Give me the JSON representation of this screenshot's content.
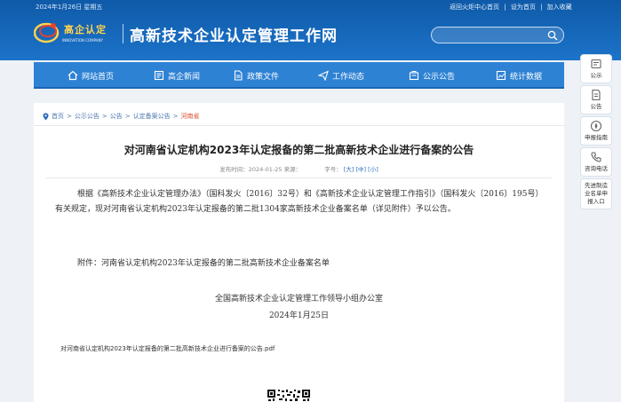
{
  "topbar": {
    "date": "2024年1月26日 星期五",
    "links": [
      "返回火炬中心首页",
      "|",
      "设为首页",
      "|",
      "加入收藏"
    ]
  },
  "brand": {
    "logo_cn": "高企认定",
    "logo_en": "INNOVATION COMPANY",
    "site_title": "高新技术企业认定管理工作网"
  },
  "search": {
    "placeholder": "",
    "icon": "search-icon"
  },
  "nav": {
    "items": [
      {
        "label": "网站首页",
        "icon": "home-icon"
      },
      {
        "label": "高企新闻",
        "icon": "news-icon"
      },
      {
        "label": "政策文件",
        "icon": "document-icon"
      },
      {
        "label": "工作动态",
        "icon": "send-icon"
      },
      {
        "label": "公示公告",
        "icon": "announcement-icon"
      },
      {
        "label": "统计数据",
        "icon": "chart-icon"
      }
    ]
  },
  "breadcrumb": {
    "items": [
      "首页",
      ">",
      "公示公告",
      ">",
      "公告",
      ">",
      "认定备案公告",
      ">"
    ],
    "current": "河南省"
  },
  "article": {
    "title": "对河南省认定机构2023年认定报备的第二批高新技术企业进行备案的公告",
    "meta_time": "发布时间：2024-01-25 来源：",
    "meta_font_label": "字号：",
    "font_sizes": [
      "[大]",
      "[中]",
      "[小]"
    ],
    "para1": "根据《高新技术企业认定管理办法》（国科发火〔2016〕32号）和《高新技术企业认定管理工作指引》（国科发火〔2016〕195号）有关规定，现对河南省认定机构2023年认定报备的第二批1304家高新技术企业备案名单（详见附件）予以公告。",
    "para2": "附件：河南省认定机构2023年认定报备的第二批高新技术企业备案名单",
    "sign_org": "全国高新技术企业认定管理工作领导小组办公室",
    "sign_date": "2024年1月25日",
    "attachment": "对河南省认定机构2023年认定报备的第二批高新技术企业进行备案的公告.pdf"
  },
  "sidebar": {
    "items": [
      {
        "label": "公示",
        "icon": "notice-icon"
      },
      {
        "label": "公告",
        "icon": "bulletin-icon"
      },
      {
        "label": "申报指南",
        "icon": "guide-icon"
      },
      {
        "label": "咨询电话",
        "icon": "phone-icon"
      },
      {
        "label": "先进制造业名单申报入口",
        "icon": ""
      }
    ]
  },
  "colors": {
    "header": "#1c73c9",
    "nav": "#2e82d4",
    "accent_red": "#d94a2a",
    "link_blue": "#2a6bb8"
  }
}
